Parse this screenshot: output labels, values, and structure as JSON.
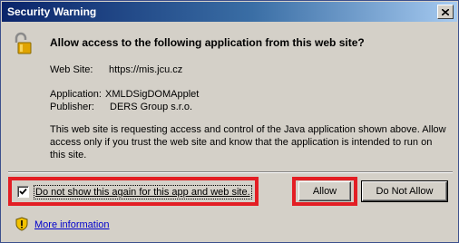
{
  "window": {
    "title": "Security Warning"
  },
  "dialog": {
    "heading": "Allow access to the following application from this web site?",
    "website_label": "Web Site:",
    "website_value": "https://mis.jcu.cz",
    "application_label": "Application:",
    "application_value": "XMLDSigDOMApplet",
    "publisher_label": "Publisher:",
    "publisher_value": "DERS Group s.r.o.",
    "description": "This web site is requesting access and control of the Java application shown above. Allow access only if you trust the web site and know that the application is intended to run on this site."
  },
  "controls": {
    "checkbox_label": "Do not show this again for this app and web site.",
    "checkbox_checked": true,
    "allow_label": "Allow",
    "deny_label": "Do Not Allow"
  },
  "footer": {
    "more_info_label": "More information"
  },
  "icons": {
    "lock": "unlocked-padlock-icon",
    "info": "shield-warning-icon",
    "close": "close-icon"
  },
  "colors": {
    "highlight": "#e31e24",
    "link": "#0000cc"
  }
}
